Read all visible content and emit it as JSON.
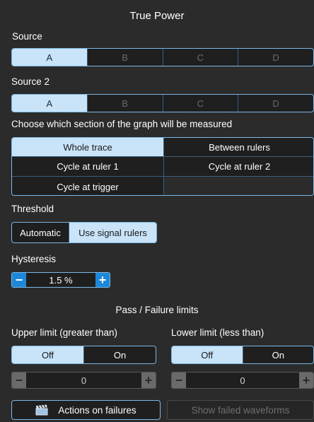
{
  "title": "True Power",
  "source": {
    "label": "Source",
    "options": [
      "A",
      "B",
      "C",
      "D"
    ],
    "selected": "A"
  },
  "source2": {
    "label": "Source 2",
    "options": [
      "A",
      "B",
      "C",
      "D"
    ],
    "selected": "A"
  },
  "section": {
    "label": "Choose which section of the graph will be measured",
    "options": [
      "Whole trace",
      "Between rulers",
      "Cycle at ruler 1",
      "Cycle at ruler 2",
      "Cycle at trigger"
    ],
    "selected": "Whole trace"
  },
  "threshold": {
    "label": "Threshold",
    "options": [
      "Automatic",
      "Use signal rulers"
    ],
    "selected": "Use signal rulers"
  },
  "hysteresis": {
    "label": "Hysteresis",
    "value": "1.5 %",
    "minus": "−",
    "plus": "+"
  },
  "limits": {
    "heading": "Pass / Failure limits",
    "upper": {
      "label": "Upper limit (greater than)",
      "options": [
        "Off",
        "On"
      ],
      "selected": "Off",
      "value": "0",
      "minus": "−",
      "plus": "+"
    },
    "lower": {
      "label": "Lower limit (less than)",
      "options": [
        "Off",
        "On"
      ],
      "selected": "Off",
      "value": "0",
      "minus": "−",
      "plus": "+"
    }
  },
  "actions": {
    "failures_label": "Actions on failures",
    "failures_icon": "clapperboard-icon",
    "show_failed_label": "Show failed waveforms"
  },
  "colors": {
    "background": "#2b2b2b",
    "selected": "#c9e3f8",
    "accent": "#1e88d8",
    "border": "#7ab8e8"
  }
}
